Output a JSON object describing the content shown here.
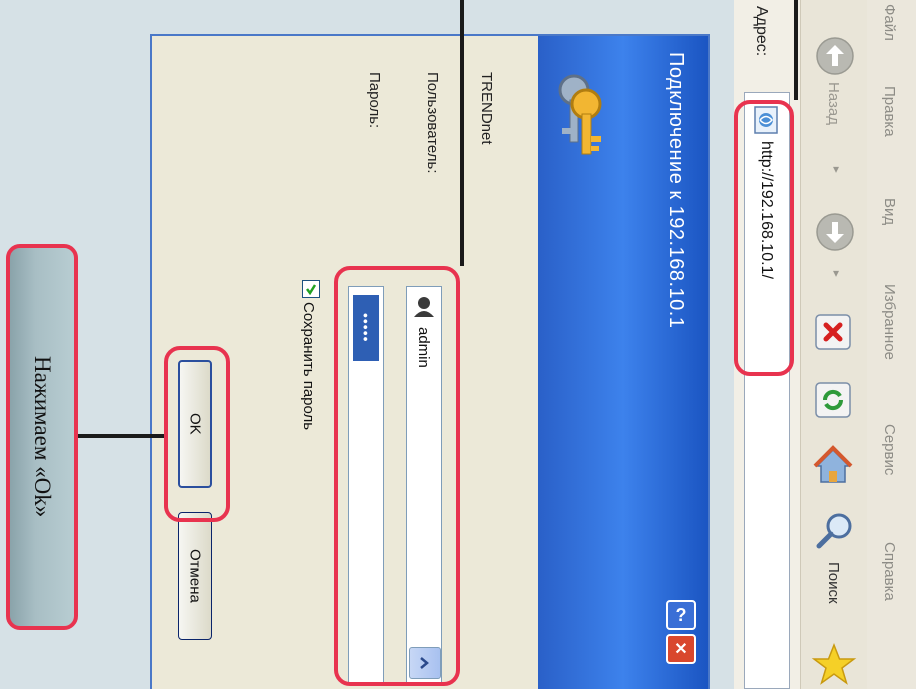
{
  "browser": {
    "menu": [
      "Файл",
      "Правка",
      "Вид",
      "Избранное",
      "Сервис",
      "Справка"
    ],
    "toolbar": {
      "back_label": "Назад",
      "search_label": "Поиск"
    },
    "address": {
      "label": "Адрес:",
      "value": "http://192.168.10.1/"
    }
  },
  "dialog": {
    "title": "Подключение к 192.168.10.1",
    "realm": "TRENDnet",
    "user_label": "Пользователь:",
    "user_value": "admin",
    "password_label": "Пароль:",
    "password_value": "•••••",
    "remember_label": "Сохранить пароль",
    "remember_checked": true,
    "ok_label": "OK",
    "cancel_label": "Отмена",
    "help_label": "?",
    "close_label": "✕"
  },
  "callout": {
    "text": "Нажимаем «Ok»"
  },
  "colors": {
    "highlight": "#e8334f",
    "titlebar": "#2a60c8",
    "callout_bg": "#a8bec4"
  }
}
